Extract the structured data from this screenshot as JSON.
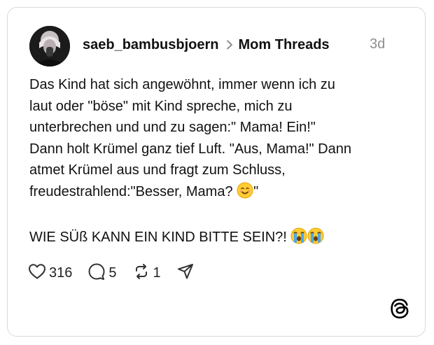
{
  "post": {
    "username": "saeb_bambusbjoern",
    "community": "Mom Threads",
    "time": "3d",
    "body_lines": [
      "Das Kind hat sich angewöhnt, immer wenn ich zu",
      "laut oder \"böse\" mit Kind spreche, mich zu",
      "unterbrechen und und zu sagen:\" Mama! Ein!\"",
      "Dann holt Krümel ganz tief Luft. \"Aus, Mama!\" Dann",
      "atmet Krümel aus und fragt zum Schluss,",
      "freudestrahlend:\"Besser, Mama? ",
      "\""
    ],
    "closing": "WIE SÜß KANN EIN KIND BITTE SEIN?! "
  },
  "actions": {
    "likes": "316",
    "replies": "5",
    "reposts": "1"
  },
  "icons": {
    "like": "heart-icon",
    "reply": "comment-icon",
    "repost": "repost-icon",
    "share": "send-icon",
    "brand": "threads-logo-icon",
    "header_sep": "chevron-right-icon"
  }
}
